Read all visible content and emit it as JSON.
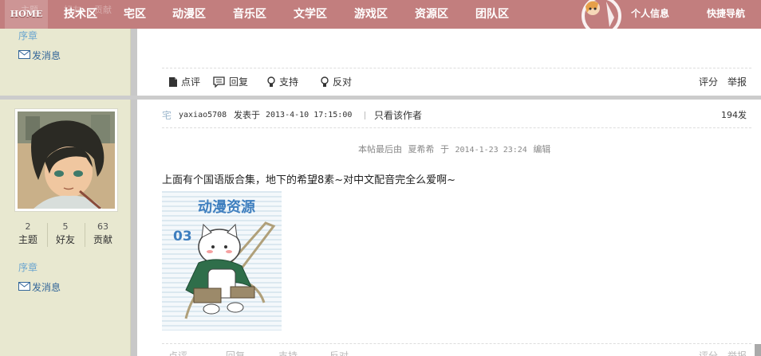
{
  "nav": {
    "home": "HOME",
    "items": [
      "技术区",
      "宅区",
      "动漫区",
      "音乐区",
      "文学区",
      "游戏区",
      "资源区",
      "团队区"
    ],
    "right": [
      "个人信息",
      "快捷导航"
    ],
    "ghost": [
      "主题",
      "好友",
      "贡献"
    ]
  },
  "sidebar_top": {
    "rank_link": "序章",
    "message": "发消息"
  },
  "actions": {
    "review": "点评",
    "reply": "回复",
    "support": "支持",
    "oppose": "反对",
    "rate": "评分",
    "report": "举报"
  },
  "author": {
    "stats": [
      {
        "value": "2",
        "label": "主题"
      },
      {
        "value": "5",
        "label": "好友"
      },
      {
        "value": "63",
        "label": "贡献"
      }
    ],
    "rank_link": "序章",
    "message": "发消息"
  },
  "post": {
    "icon_glyph": "宅",
    "author": "yaxiao5708",
    "posted_label": "发表于",
    "time": "2013-4-10 17:15:00",
    "only_author": "只看该作者",
    "floor": "194发",
    "edited_prefix": "本帖最后由",
    "editor": "夏希希",
    "edited_at_label": "于",
    "edited_time": "2014-1-23 23:24",
    "edited_suffix": "编辑",
    "content": "上面有个国语版合集，地下的希望8素~对中文配音完全么爱啊~",
    "image_title": "动漫资源",
    "image_number": "03"
  },
  "colors": {
    "nav_bg": "#c27e7e",
    "sidebar_bg": "#e8e8d0",
    "link": "#6aa5cf"
  }
}
